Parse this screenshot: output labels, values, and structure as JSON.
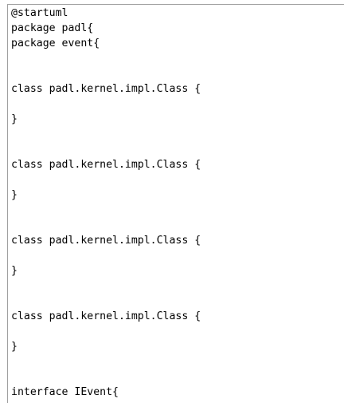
{
  "editor": {
    "lines": [
      "@startuml",
      "package padl{",
      "package event{",
      "class padl.kernel.impl.Class {",
      "}",
      "class padl.kernel.impl.Class {",
      "}",
      "class padl.kernel.impl.Class {",
      "}",
      "class padl.kernel.impl.Class {",
      "}",
      "interface IEvent{"
    ]
  }
}
